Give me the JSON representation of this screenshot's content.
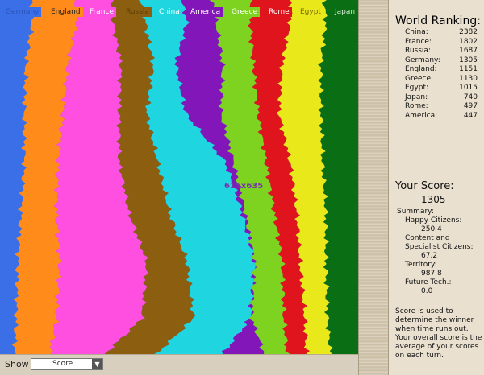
{
  "legend": [
    {
      "name": "Germany",
      "color": "#3a6fe8",
      "text_color": "#2a53b8"
    },
    {
      "name": "England",
      "color": "#ff8c1a",
      "text_color": "#222222"
    },
    {
      "name": "France",
      "color": "#ff4fe0",
      "text_color": "#ffffff"
    },
    {
      "name": "Russia",
      "color": "#8b5e10",
      "text_color": "#5c3d08"
    },
    {
      "name": "China",
      "color": "#1fd6e0",
      "text_color": "#ffffff"
    },
    {
      "name": "America",
      "color": "#8216b8",
      "text_color": "#ffffff"
    },
    {
      "name": "Greece",
      "color": "#7ed321",
      "text_color": "#ffffff"
    },
    {
      "name": "Rome",
      "color": "#e0141c",
      "text_color": "#ffffff"
    },
    {
      "name": "Egypt",
      "color": "#e8e81a",
      "text_color": "#7a6a00"
    },
    {
      "name": "Japan",
      "color": "#0a6e14",
      "text_color": "#cfe8cf"
    }
  ],
  "cursor_label": "615x635",
  "bottom_bar": {
    "show_label": "Show",
    "select_value": "Score"
  },
  "ranking": {
    "title": "World Ranking:",
    "rows": [
      {
        "name": "China:",
        "score": "2382"
      },
      {
        "name": "France:",
        "score": "1802"
      },
      {
        "name": "Russia:",
        "score": "1687"
      },
      {
        "name": "Germany:",
        "score": "1305"
      },
      {
        "name": "England:",
        "score": "1151"
      },
      {
        "name": "Greece:",
        "score": "1130"
      },
      {
        "name": "Egypt:",
        "score": "1015"
      },
      {
        "name": "Japan:",
        "score": "740"
      },
      {
        "name": "Rome:",
        "score": "497"
      },
      {
        "name": "America:",
        "score": "447"
      }
    ]
  },
  "score": {
    "title": "Your Score:",
    "value": "1305",
    "summary_label": "Summary:",
    "items": [
      {
        "label": "Happy Citizens:",
        "value": "250.4"
      },
      {
        "label": "Content and Specialist Citizens:",
        "value": "67.2"
      },
      {
        "label": "Territory:",
        "value": "987.8"
      },
      {
        "label": "Future Tech.:",
        "value": "0.0"
      }
    ],
    "note": "Score is used to determine the winner when time runs out. Your overall score is the average of your scores on each turn."
  }
}
